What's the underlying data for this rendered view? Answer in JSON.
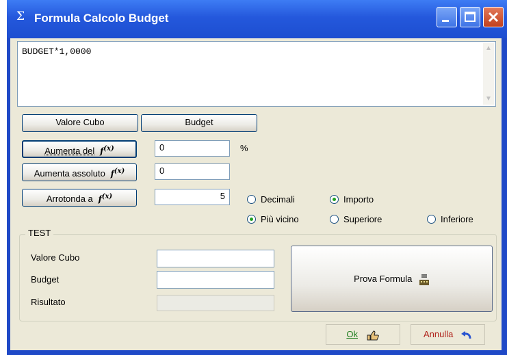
{
  "window": {
    "title": "Formula Calcolo Budget",
    "title_icon": "sigma-icon"
  },
  "formula": {
    "text": "BUDGET*1,0000"
  },
  "buttons": {
    "valore_cubo": "Valore Cubo",
    "budget": "Budget",
    "aumenta_del": "Aumenta del",
    "aumenta_assoluto": "Aumenta assoluto",
    "arrotonda_a": "Arrotonda a",
    "prova_formula": "Prova Formula",
    "ok": "Ok",
    "annulla": "Annulla"
  },
  "inputs": {
    "aumenta_del_value": "0",
    "aumenta_assoluto_value": "0",
    "arrotonda_value": "5",
    "percent_suffix": "%"
  },
  "radios": {
    "decimali": {
      "label": "Decimali",
      "checked": false
    },
    "importo": {
      "label": "Importo",
      "checked": true
    },
    "piu_vicino": {
      "label": "Più vicino",
      "checked": true
    },
    "superiore": {
      "label": "Superiore",
      "checked": false
    },
    "inferiore": {
      "label": "Inferiore",
      "checked": false
    }
  },
  "test": {
    "title": "TEST",
    "valore_cubo_label": "Valore Cubo",
    "budget_label": "Budget",
    "risultato_label": "Risultato",
    "valore_cubo_value": "",
    "budget_value": "",
    "risultato_value": ""
  },
  "colors": {
    "titlebar": "#2458dc",
    "client": "#ece9d8",
    "ok": "#1e7d1e",
    "annulla": "#b0241c"
  }
}
